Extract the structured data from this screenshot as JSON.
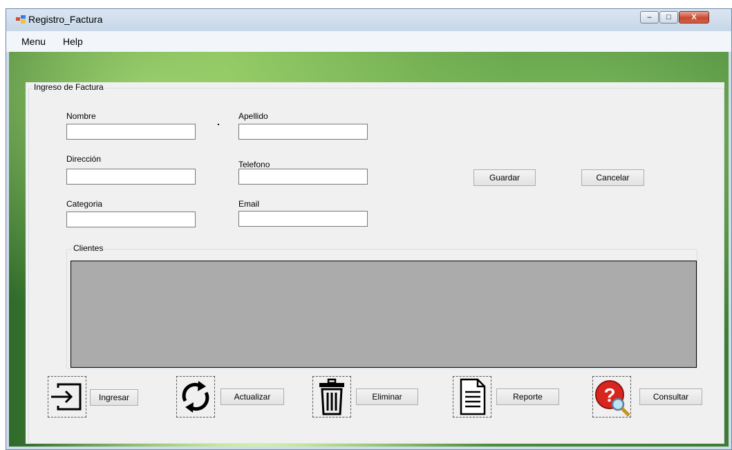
{
  "window": {
    "title": "Registro_Factura",
    "controls": {
      "minimize": "–",
      "maximize": "□",
      "close": "X"
    }
  },
  "menu": {
    "items": [
      "Menu",
      "Help"
    ]
  },
  "groupbox": {
    "title": "Ingreso de Factura"
  },
  "fields": {
    "nombre": {
      "label": "Nombre",
      "value": ""
    },
    "apellido": {
      "label": "Apellido",
      "value": ""
    },
    "direccion": {
      "label": "Dirección",
      "value": ""
    },
    "telefono": {
      "label": "Telefono",
      "value": ""
    },
    "categoria": {
      "label": "Categoria",
      "value": ""
    },
    "email": {
      "label": "Email",
      "value": ""
    }
  },
  "buttons": {
    "guardar": "Guardar",
    "cancelar": "Cancelar",
    "ingresar": "Ingresar",
    "actualizar": "Actualizar",
    "eliminar": "Eliminar",
    "reporte": "Reporte",
    "consultar": "Consultar"
  },
  "clientes": {
    "title": "Clientes"
  },
  "icons": {
    "ingresar": "login-arrow-icon",
    "actualizar": "refresh-icon",
    "eliminar": "trash-icon",
    "reporte": "document-icon",
    "consultar": "help-search-icon"
  }
}
